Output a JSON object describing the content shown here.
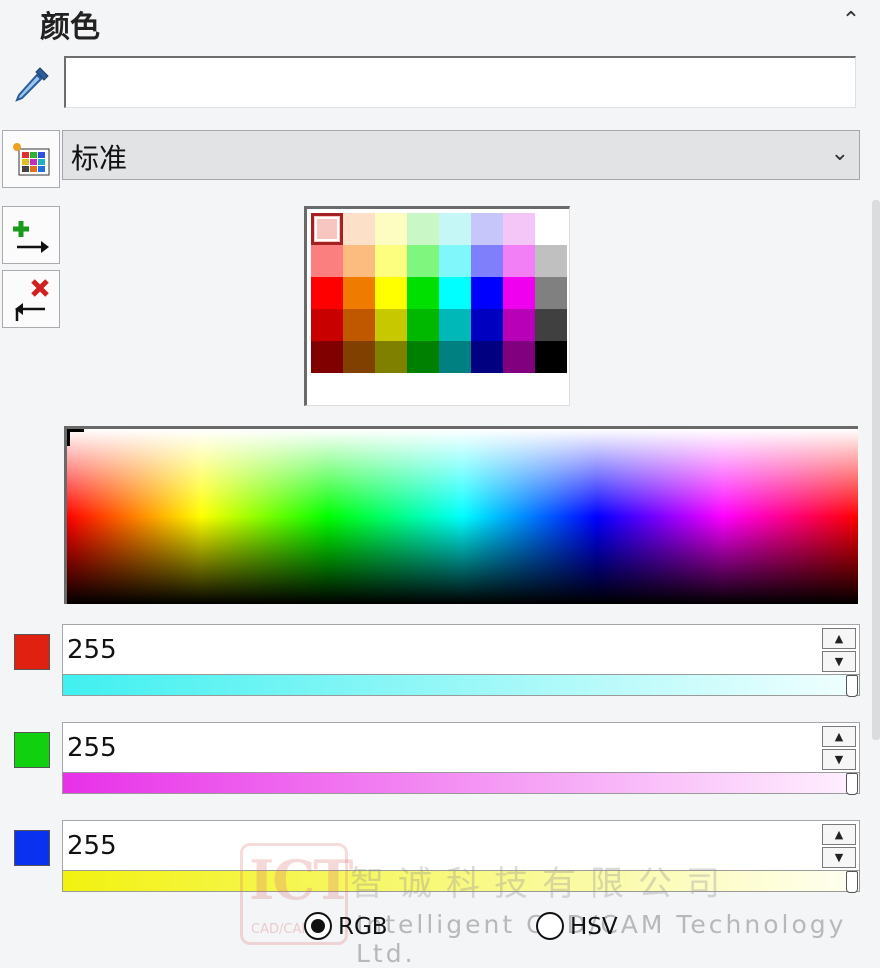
{
  "panel": {
    "title": "颜色",
    "collapse_icon": "chevron-up-icon"
  },
  "hex_input": {
    "value": ""
  },
  "palette": {
    "selected": "标准",
    "dropdown_icon": "chevron-down-icon"
  },
  "swatches": {
    "rows": [
      [
        "#f8c6c1",
        "#fde0c8",
        "#fdfdc2",
        "#c9f7c6",
        "#c6f7f7",
        "#c6c6fb",
        "#f3c6f7",
        "#ffffff"
      ],
      [
        "#fb7f7f",
        "#fdbc7f",
        "#fdfd7f",
        "#7ff77f",
        "#7ff7fb",
        "#7f7ffb",
        "#f37ff7",
        "#c0c0c0"
      ],
      [
        "#ff0000",
        "#ef7b00",
        "#ffff00",
        "#00e000",
        "#00ffff",
        "#0000ff",
        "#ef00ef",
        "#808080"
      ],
      [
        "#c80000",
        "#c05800",
        "#c8c800",
        "#00b800",
        "#00b8b8",
        "#0000c0",
        "#b800b8",
        "#404040"
      ],
      [
        "#800000",
        "#804000",
        "#808000",
        "#008000",
        "#008080",
        "#000080",
        "#800080",
        "#000000"
      ]
    ],
    "selected_index": [
      0,
      0
    ]
  },
  "channels": [
    {
      "name": "red",
      "value": "255",
      "swatch_color": "#e02010",
      "bar_from": "#40f0f0",
      "bar_to": "#f2ffff"
    },
    {
      "name": "green",
      "value": "255",
      "swatch_color": "#10d010",
      "bar_from": "#e830e8",
      "bar_to": "#fff2ff"
    },
    {
      "name": "blue",
      "value": "255",
      "swatch_color": "#0a30f0",
      "bar_from": "#f2f210",
      "bar_to": "#fffff2"
    }
  ],
  "spin": {
    "up": "▲",
    "down": "▼"
  },
  "mode": {
    "rgb_label": "RGB",
    "hsv_label": "HSV",
    "selected": "RGB"
  },
  "watermark": {
    "logo_text": "ICT",
    "logo_subtext": "CAD/CAM",
    "cn_text": "智诚科技有限公司",
    "en_text": "Intelligent CAD/CAM Technology Ltd."
  }
}
